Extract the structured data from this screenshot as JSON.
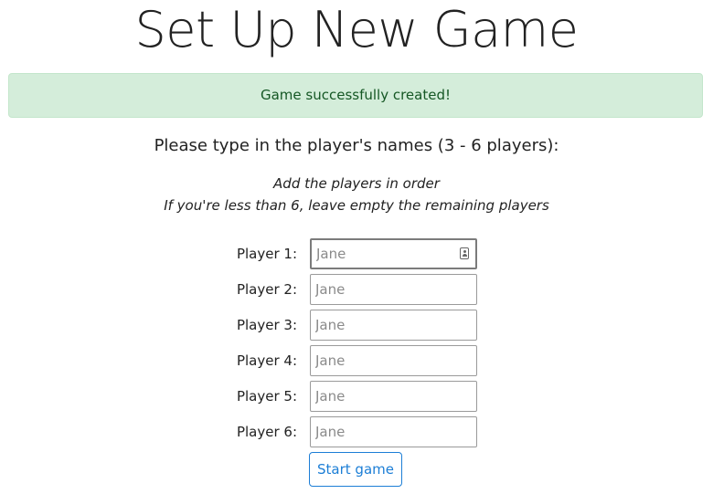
{
  "page": {
    "title": "Set Up New Game"
  },
  "alert": {
    "message": "Game successfully created!",
    "type": "success",
    "colors": {
      "background": "#d4edda",
      "text": "#155724",
      "border": "#c3e6cb"
    }
  },
  "instructions": {
    "heading": "Please type in the player's names (3 - 6 players):",
    "hint_line_1": "Add the players in order",
    "hint_line_2": "If you're less than 6, leave empty the remaining players"
  },
  "players": [
    {
      "label": "Player 1:",
      "placeholder": "Jane",
      "value": ""
    },
    {
      "label": "Player 2:",
      "placeholder": "Jane",
      "value": ""
    },
    {
      "label": "Player 3:",
      "placeholder": "Jane",
      "value": ""
    },
    {
      "label": "Player 4:",
      "placeholder": "Jane",
      "value": ""
    },
    {
      "label": "Player 5:",
      "placeholder": "Jane",
      "value": ""
    },
    {
      "label": "Player 6:",
      "placeholder": "Jane",
      "value": ""
    }
  ],
  "icons": {
    "autofill": "contact-card-icon"
  },
  "actions": {
    "start_label": "Start game",
    "accent_color": "#1c7ed6"
  }
}
